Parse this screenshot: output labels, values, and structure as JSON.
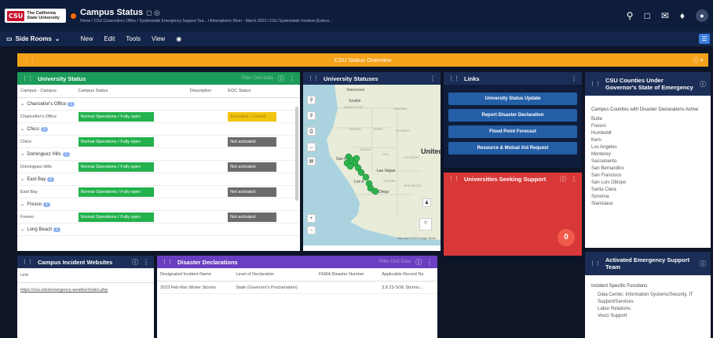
{
  "app": {
    "logo_abbrev": "CSU",
    "logo_text": "The California State University",
    "title": "Campus Status",
    "title_icons": "◻ ◎",
    "breadcrumb": "Home / CSU Chancellor's Office / Systemwide Emergency Support Tea... / Atmospheric River - March 2023 / CSU Systemwide Incident (Extens..."
  },
  "menu": {
    "side_rooms": "Side Rooms",
    "new": "New",
    "edit": "Edit",
    "tools": "Tools",
    "view": "View"
  },
  "banner": {
    "title": "CSU Status Overview"
  },
  "university_status": {
    "title": "University Status",
    "hint": "Filter Grid Data",
    "columns": [
      "Campus - Campus",
      "Campus Status",
      "Description",
      "EOC Status"
    ],
    "rows": [
      {
        "kind": "group",
        "label": "Chancellor's Office",
        "badge": "1"
      },
      {
        "kind": "row",
        "campus": "Chancellor's Office",
        "status": "Normal Operations / Fully open",
        "eoc": "Activated - Lowest",
        "eoc_color": "yellow"
      },
      {
        "kind": "group",
        "label": "Chico",
        "badge": "1"
      },
      {
        "kind": "row",
        "campus": "Chico",
        "status": "Normal Operations / Fully open",
        "eoc": "Not activated",
        "eoc_color": "gray"
      },
      {
        "kind": "group",
        "label": "Dominguez Hills",
        "badge": "1"
      },
      {
        "kind": "row",
        "campus": "Dominguez Hills",
        "status": "Normal Operations / Fully open",
        "eoc": "Not activated",
        "eoc_color": "gray"
      },
      {
        "kind": "group",
        "label": "East Bay",
        "badge": "1"
      },
      {
        "kind": "row",
        "campus": "East Bay",
        "status": "Normal Operations / Fully open",
        "eoc": "Not activated",
        "eoc_color": "gray"
      },
      {
        "kind": "group",
        "label": "Fresno",
        "badge": "1"
      },
      {
        "kind": "row",
        "campus": "Fresno",
        "status": "Normal Operations / Fully open",
        "eoc": "Not activated",
        "eoc_color": "gray"
      },
      {
        "kind": "group",
        "label": "Long Beach",
        "badge": "1"
      }
    ]
  },
  "statuses": {
    "title": "University Statuses",
    "map_labels": [
      "Vancouver",
      "Seattle",
      "WASHINGTON",
      "MONTANA",
      "OREGON",
      "IDAHO",
      "WYOMING",
      "NEVADA",
      "UTAH",
      "COLORADO",
      "United",
      "San F",
      "Las Vegas",
      "ARIZONA",
      "NEW MEXICO",
      "Los A",
      "San Diego"
    ],
    "attribution": "Map data ©2023 Google  Terms"
  },
  "links": {
    "title": "Links",
    "buttons": [
      "University Status Update",
      "Report Disaster Declaration",
      "Flood Point Forecast",
      "Resource & Mutual Aid Request"
    ]
  },
  "seeking": {
    "title": "Universities Seeking Support",
    "count": "0"
  },
  "counties": {
    "title": "CSU Counties Under Governor's State of Emergency",
    "subtitle": "Campus Counties with Disaster Declarations Active",
    "items": [
      "Butte",
      "Fresno",
      "Humboldt",
      "Kern",
      "Los Angeles",
      "Monterey",
      "Sacramento",
      "San Bernardino",
      "San Francisco",
      "San Luis Obispo",
      "Santa Clara",
      "Sonoma",
      "Stanislaus"
    ]
  },
  "incident_websites": {
    "title": "Campus Incident Websites",
    "col": "Link",
    "value": "https://csu.edu/emergency-weather/index.php"
  },
  "declarations": {
    "title": "Disaster Declarations",
    "hint": "Filter Grid Data",
    "columns": [
      "Designated Incident Name",
      "Level of Declaration",
      "FEMA Disaster Number",
      "Applicable Record Nu"
    ],
    "row": [
      "2023 Feb-Mar Winter Storms",
      "State (Governor's Proclamation)",
      "",
      "3.8.23-SOE Storms..."
    ]
  },
  "esf": {
    "title": "Activated Emergency Support Team",
    "subtitle": "Incident Specific Functions",
    "items": [
      "Data Center, Information Systems/Security, IT Support/Services",
      "Labor Relations",
      "Veoci Support"
    ]
  }
}
